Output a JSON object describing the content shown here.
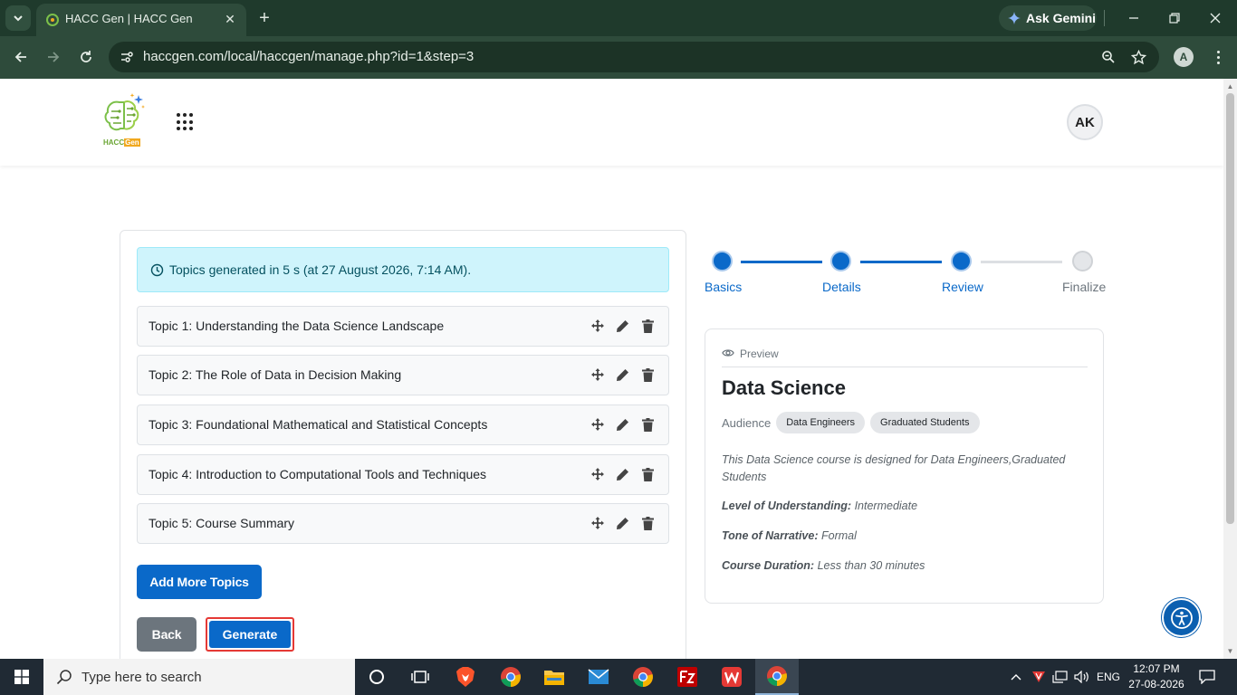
{
  "browser": {
    "tab_title": "HACC Gen | HACC Gen",
    "url": "haccgen.com/local/haccgen/manage.php?id=1&step=3",
    "gemini_label": "Ask Gemini",
    "profile_initial": "A"
  },
  "header": {
    "logo_text_1": "HACC",
    "logo_text_2": "Gen",
    "avatar_initials": "AK"
  },
  "alert": {
    "text": "Topics generated in 5 s (at 27 August 2026, 7:14 AM)."
  },
  "topics": [
    "Topic 1: Understanding the Data Science Landscape",
    "Topic 2: The Role of Data in Decision Making",
    "Topic 3: Foundational Mathematical and Statistical Concepts",
    "Topic 4: Introduction to Computational Tools and Techniques",
    "Topic 5: Course Summary"
  ],
  "buttons": {
    "add_more": "Add More Topics",
    "back": "Back",
    "generate": "Generate"
  },
  "stepper": {
    "steps": [
      {
        "label": "Basics",
        "state": "done"
      },
      {
        "label": "Details",
        "state": "done"
      },
      {
        "label": "Review",
        "state": "done"
      },
      {
        "label": "Finalize",
        "state": "todo"
      }
    ]
  },
  "preview": {
    "heading": "Preview",
    "title": "Data Science",
    "audience_label": "Audience",
    "audiences": [
      "Data Engineers",
      "Graduated Students"
    ],
    "description": "This Data Science course is designed for Data Engineers,Graduated Students",
    "level_label": "Level of Understanding:",
    "level_value": "Intermediate",
    "tone_label": "Tone of Narrative:",
    "tone_value": "Formal",
    "duration_label": "Course Duration:",
    "duration_value": "Less than 30 minutes"
  },
  "taskbar": {
    "search_placeholder": "Type here to search",
    "language": "ENG",
    "time": "12:07 PM",
    "date": "27-08-2026"
  },
  "colors": {
    "primary": "#0a69c9",
    "alert_bg": "#cff4fc",
    "browser_chrome": "#2e4b3b"
  }
}
